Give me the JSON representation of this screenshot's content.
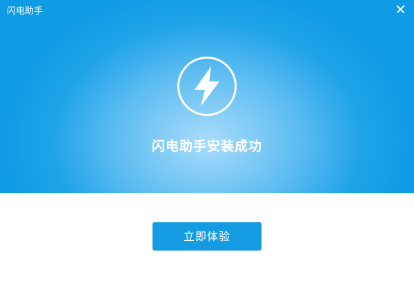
{
  "window": {
    "title": "闪电助手"
  },
  "hero": {
    "message": "闪电助手安装成功"
  },
  "actions": {
    "primary_label": "立即体验"
  },
  "icons": {
    "close": "close-icon",
    "logo": "lightning-bolt-icon"
  },
  "colors": {
    "hero_blue": "#0f9ae4",
    "hero_glow": "#a9dcfb",
    "button_blue": "#159be2",
    "text_white": "#ffffff"
  }
}
